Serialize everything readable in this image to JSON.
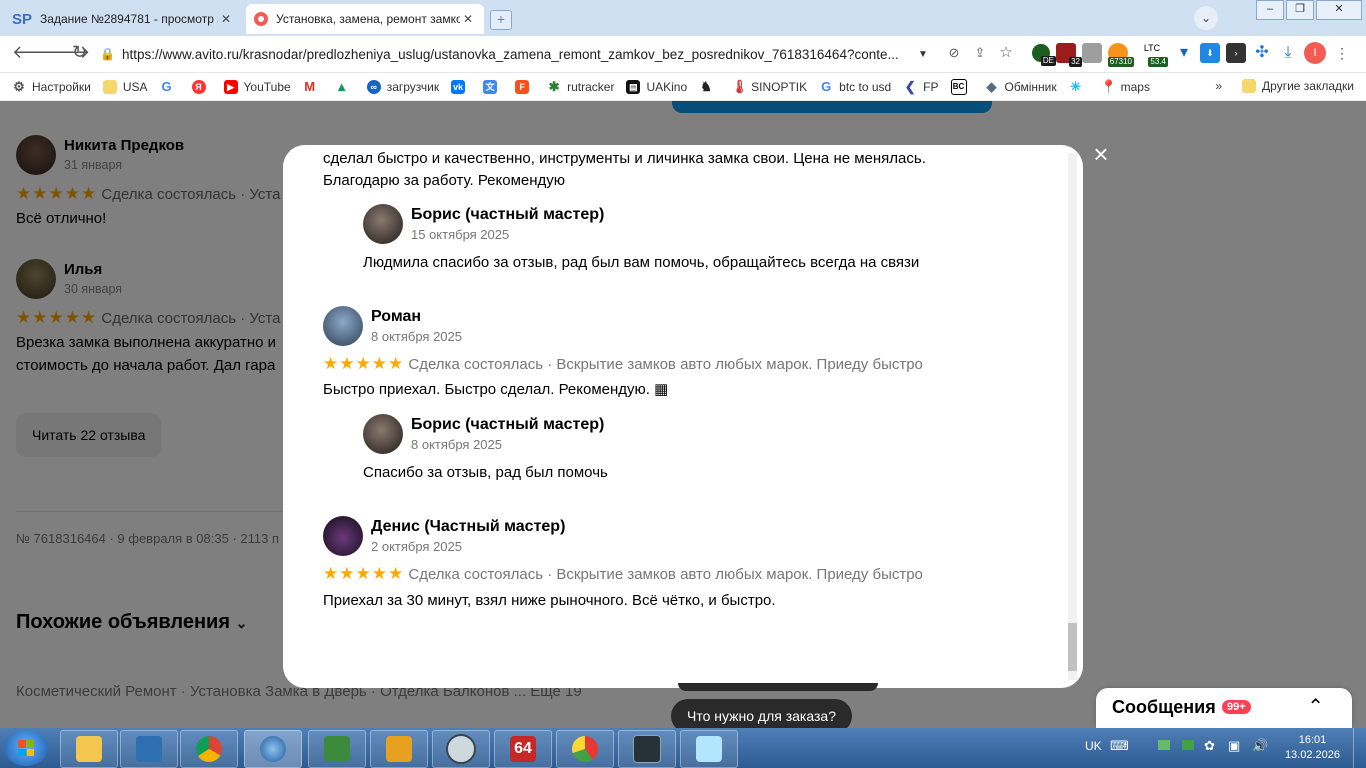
{
  "browser": {
    "tabs": [
      {
        "title": "Задание №2894781 - просмотр з",
        "active": false
      },
      {
        "title": "Установка, замена, ремонт замко",
        "active": true
      }
    ],
    "url": "https://www.avito.ru/krasnodar/predlozheniya_uslug/ustanovka_zamena_remont_zamkov_bez_posrednikov_7618316464?conte...",
    "extensions": {
      "de_badge": "DE",
      "count_badge": "32",
      "btc_badge": "67310",
      "ltc_label": "LTC",
      "ltc_badge": "53.4",
      "profile_letter": "I"
    },
    "bookmarks": [
      "Настройки",
      "USA",
      "",
      "",
      "YouTube",
      "",
      "",
      "загрузчик",
      "",
      "",
      "",
      "rutracker",
      "UAKino",
      "",
      "SINOPTIK",
      "btc to usd",
      "FP",
      "",
      "Обмінник",
      "",
      "maps"
    ],
    "bookmarks_more": "»",
    "other_bookmarks": "Другие закладки"
  },
  "page": {
    "reviews": [
      {
        "name": "Никита Предков",
        "date": "31 января",
        "deal": "Сделка состоялась · Уста",
        "text": "Всё отлично!"
      },
      {
        "name": "Илья",
        "date": "30 января",
        "deal": "Сделка состоялась · Уста",
        "text_line1": "Врезка замка выполнена аккуратно и",
        "text_line2": "стоимость до начала работ. Дал гара"
      }
    ],
    "stars": "★★★★★",
    "read_reviews_button": "Читать 22 отзыва",
    "meta": "№ 7618316464 · 9 февраля в 08:35 · 2113 п",
    "similar_heading": "Похожие объявления",
    "similar_tags": "Косметический Ремонт · Установка Замка в Дверь · Отделка Балконов ... Еще 19",
    "ask_button": "Что нужно для заказа?",
    "messages": {
      "title": "Сообщения",
      "badge": "99+"
    }
  },
  "modal": {
    "close_label": "×",
    "top_review_text_line1": "сделал быстро и качественно, инструменты и личинка замка свои. Цена не менялась.",
    "top_review_text_line2": "Благодарю за работу. Рекомендую",
    "items": [
      {
        "kind": "reply",
        "name": "Борис (частный мастер)",
        "date": "15 октября 2025",
        "text": "Людмила спасибо за отзыв, рад был вам помочь, обращайтесь всегда на связи"
      },
      {
        "kind": "review",
        "name": "Роман",
        "date": "8 октября 2025",
        "deal": "Сделка состоялась · Вскрытие замков авто любых марок. Приеду быстро",
        "text": "Быстро приехал. Быстро сделал. Рекомендую. ▦"
      },
      {
        "kind": "reply",
        "name": "Борис (частный мастер)",
        "date": "8 октября 2025",
        "text": "Спасибо за отзыв, рад был помочь"
      },
      {
        "kind": "review",
        "name": "Денис (Частный мастер)",
        "date": "2 октября 2025",
        "deal": "Сделка состоялась · Вскрытие замков авто любых марок. Приеду быстро",
        "text": "Приехал за 30 минут, взял ниже рыночного. Всё чётко, и быстро."
      }
    ],
    "star_color": "#ffa800"
  },
  "taskbar": {
    "lang": "UK",
    "time": "16:01",
    "date": "13.02.2026",
    "aida_label": "64"
  }
}
